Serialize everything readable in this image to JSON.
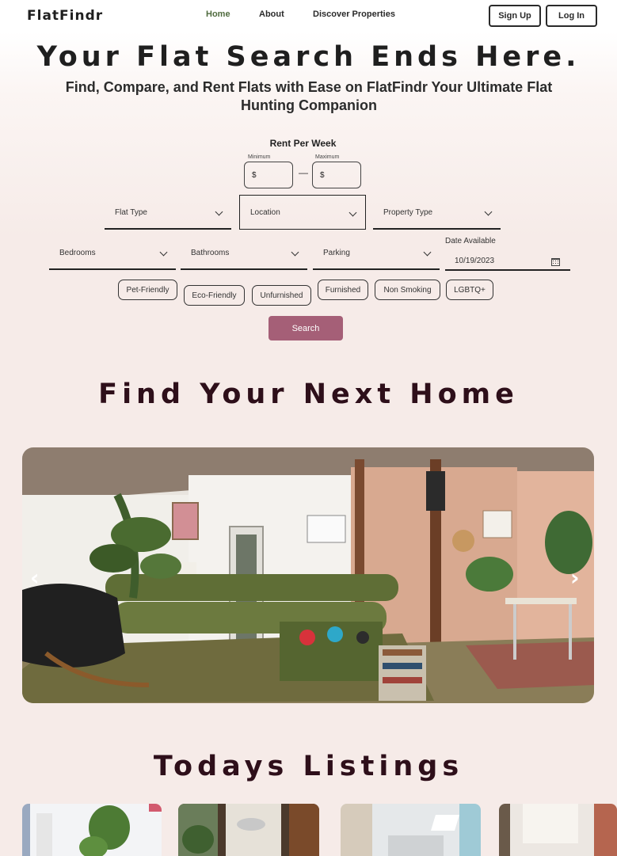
{
  "brand": {
    "logo": "FlatFindr",
    "accent": "#a55f77",
    "active_nav": "#4f6b3e",
    "title_dark": "#2e0f1a"
  },
  "nav": {
    "links": [
      "Home",
      "About",
      "Discover Properties"
    ],
    "signup": "Sign Up",
    "login": "Log In"
  },
  "hero": {
    "title": "Your Flat Search Ends Here.",
    "subtitle": "Find, Compare, and Rent Flats with Ease on FlatFindr Your Ultimate Flat Hunting Companion"
  },
  "search": {
    "rent_label": "Rent Per Week",
    "min_label": "Minimum",
    "max_label": "Maximum",
    "currency": "$",
    "dash": "—",
    "flat_type": "Flat Type",
    "location": "Location",
    "property_type": "Property Type",
    "bedrooms": "Bedrooms",
    "bathrooms": "Bathrooms",
    "parking": "Parking",
    "date_label": "Date Available",
    "date_value": "10/19/2023",
    "chips": [
      "Pet-Friendly",
      "Eco-Friendly",
      "Unfurnished",
      "Furnished",
      "Non Smoking",
      "LGBTQ+"
    ],
    "button": "Search"
  },
  "carousel": {
    "title": "Find Your Next Home",
    "prev": "‹",
    "next": "›"
  },
  "listings": {
    "title": "Todays Listings"
  }
}
